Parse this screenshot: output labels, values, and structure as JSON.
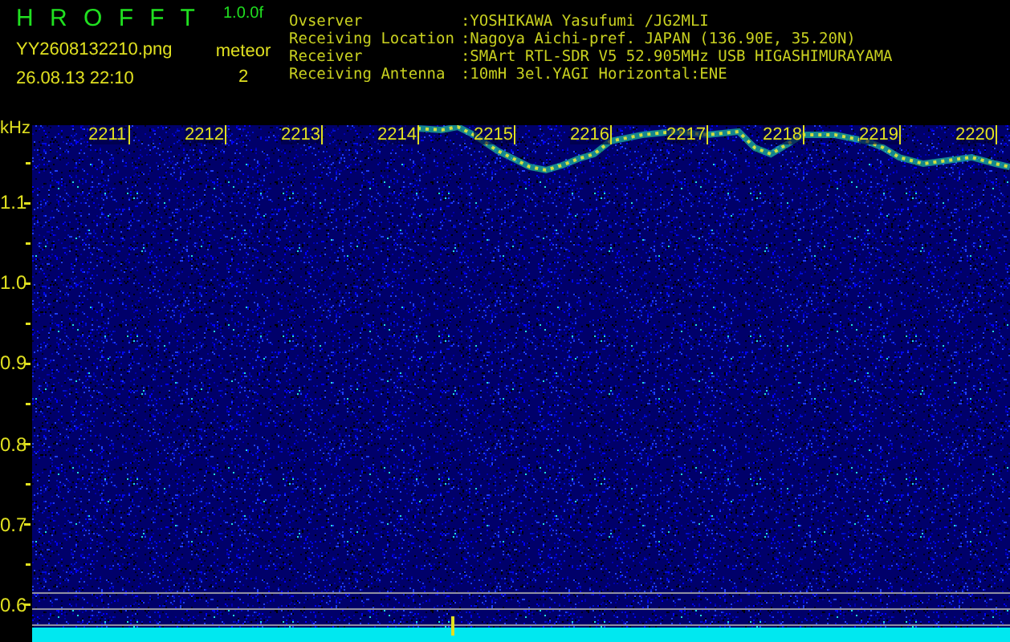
{
  "header": {
    "app_name": "H R O F F T",
    "version": "1.0.0f",
    "file_name": "YY2608132210.png",
    "timestamp": "26.08.13 22:10",
    "count_label": "meteor",
    "count": "2"
  },
  "station_info": [
    {
      "label": "Ovserver",
      "value": ":YOSHIKAWA Yasufumi /JG2MLI"
    },
    {
      "label": "Receiving Location",
      "value": ":Nagoya Aichi-pref. JAPAN (136.90E, 35.20N)"
    },
    {
      "label": "Receiver",
      "value": ":SMArt RTL-SDR V5 52.905MHz USB HIGASHIMURAYAMA"
    },
    {
      "label": "Receiving Antenna",
      "value": ":10mH 3el.YAGI Horizontal:ENE"
    }
  ],
  "spectrogram": {
    "y_unit": "kHz",
    "y_labels": [
      "1.1",
      "1.0",
      "0.9",
      "0.8",
      "0.7",
      "0.6"
    ],
    "time_labels": [
      "2211",
      "2212",
      "2213",
      "2214",
      "2215",
      "2216",
      "2217",
      "2218",
      "2219",
      "2220"
    ]
  }
}
